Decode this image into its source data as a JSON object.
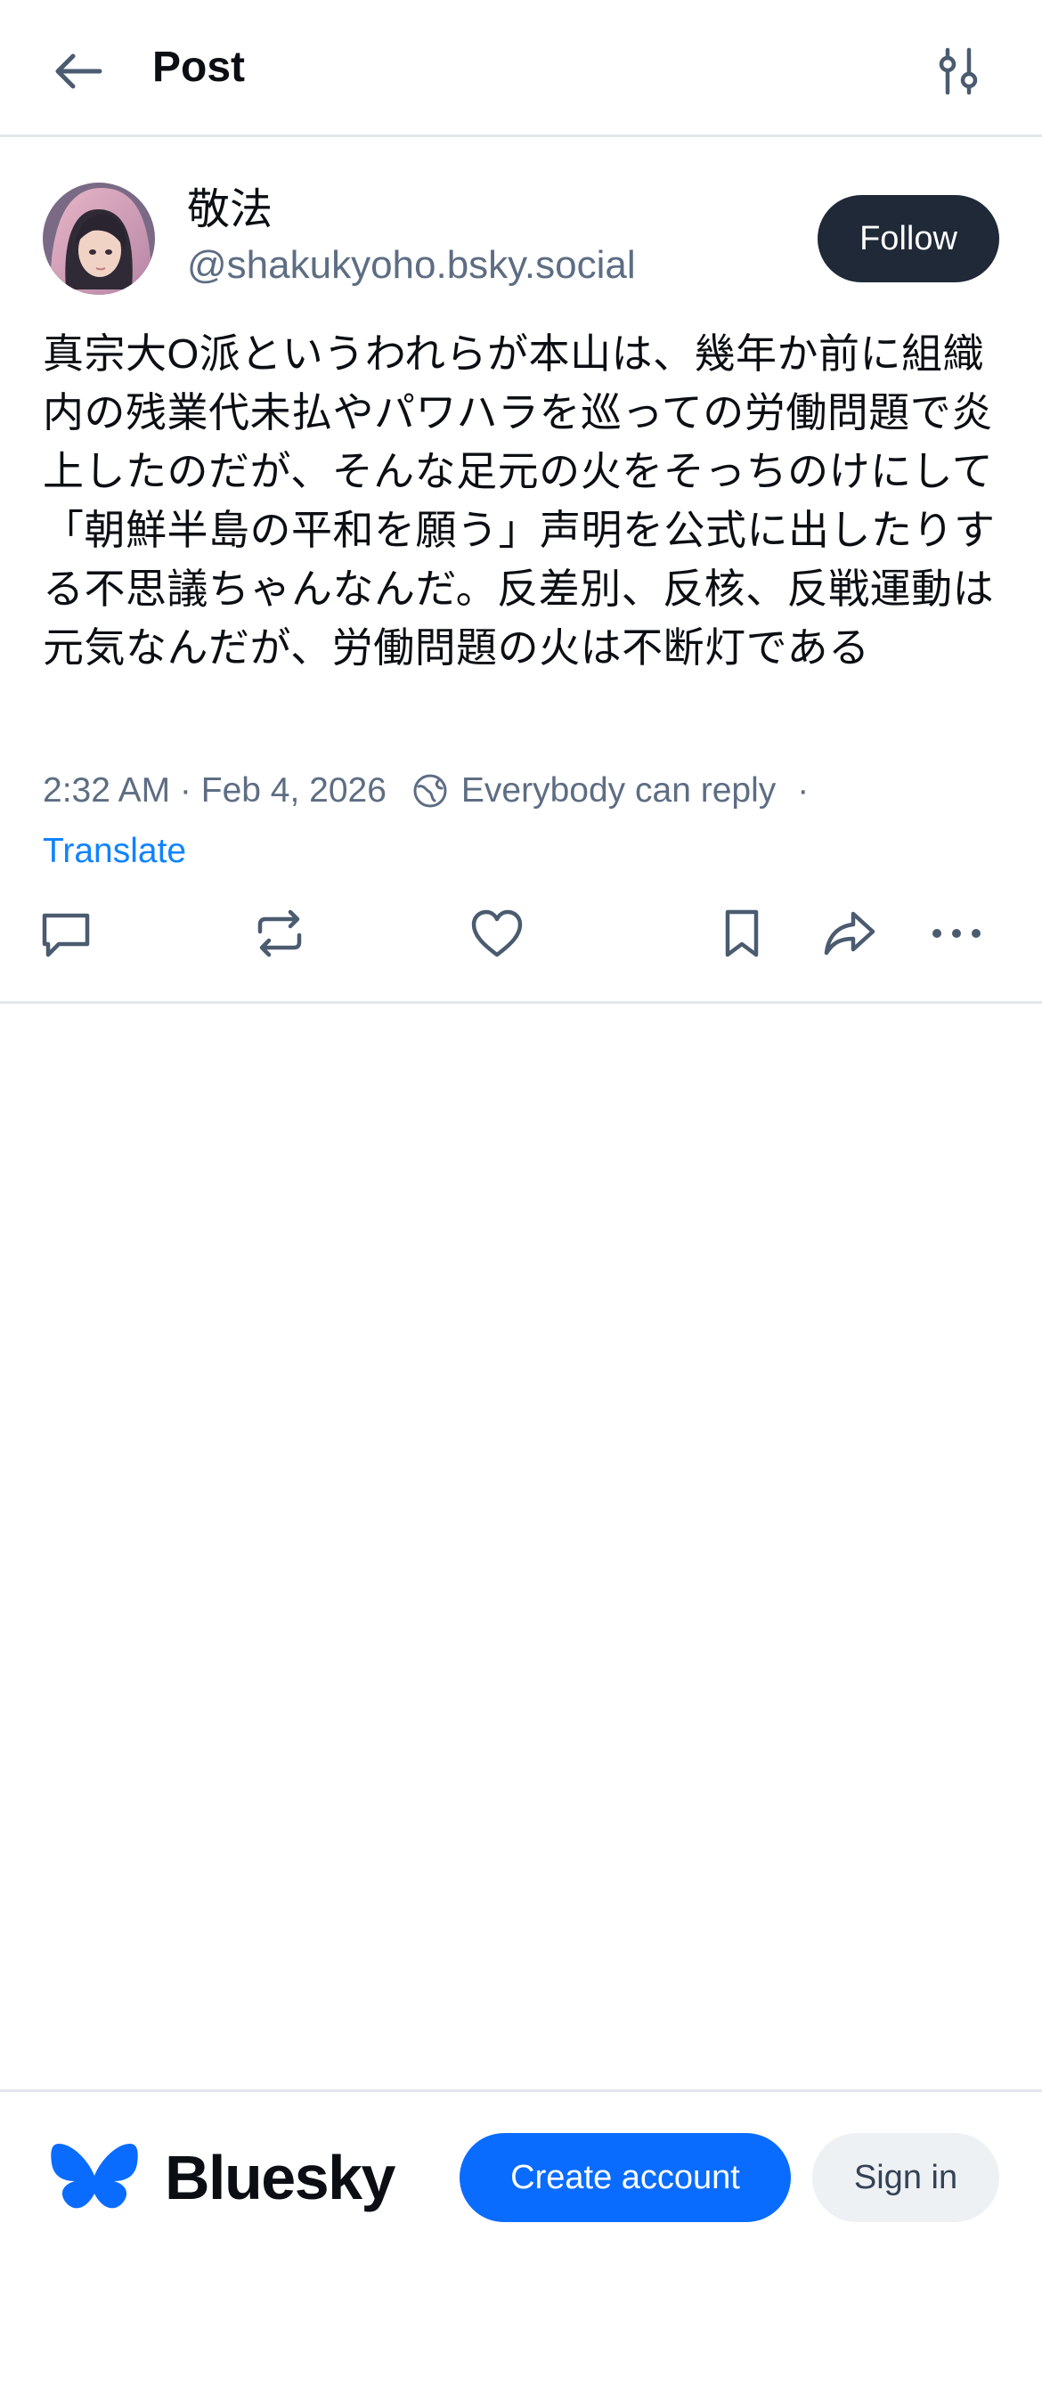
{
  "header": {
    "title": "Post",
    "back_icon": "arrow-left-icon",
    "settings_icon": "sliders-icon"
  },
  "author": {
    "display_name": "敬法",
    "handle": "@shakukyoho.bsky.social",
    "follow_label": "Follow"
  },
  "post": {
    "text": "真宗大O派というわれらが本山は、幾年か前に組織内の残業代未払やパワハラを巡っての労働問題で炎上したのだが、そんな足元の火をそっちのけにして「朝鮮半島の平和を願う」声明を公式に出したりする不思議ちゃんなんだ。反差別、反核、反戦運動は元気なんだが、労働問題の火は不断灯である",
    "timestamp": "2:32 AM · Feb 4, 2026",
    "reply_setting": "Everybody can reply",
    "separator": "·",
    "translate_label": "Translate"
  },
  "actions": [
    "reply-icon",
    "repost-icon",
    "like-icon",
    "bookmark-icon",
    "share-icon",
    "more-icon"
  ],
  "footer": {
    "brand": "Bluesky",
    "create_account": "Create account",
    "sign_in": "Sign in"
  },
  "colors": {
    "accent": "#0a6cff",
    "link": "#1083fe",
    "muted": "#5d6d83",
    "follow_bg": "#1f2937",
    "divider": "#e3e7ec"
  }
}
